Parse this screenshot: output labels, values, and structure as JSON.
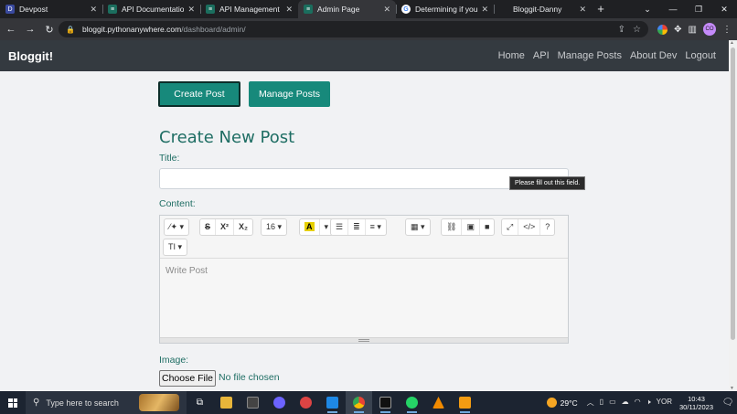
{
  "browser": {
    "tabs": [
      {
        "favicon": "D",
        "favicon_color": "#3a4a9f",
        "title": "Devpost",
        "active": false
      },
      {
        "favicon": "≡",
        "favicon_color": "#1b6e5e",
        "title": "API Documentation",
        "active": false
      },
      {
        "favicon": "≡",
        "favicon_color": "#1b6e5e",
        "title": "API Management",
        "active": false
      },
      {
        "favicon": "≡",
        "favicon_color": "#1b6e5e",
        "title": "Admin Page",
        "active": true
      },
      {
        "favicon": "G",
        "favicon_color": "#ffffff",
        "title": "Determining if your",
        "active": false
      },
      {
        "favicon": "",
        "favicon_color": "transparent",
        "title": "Bloggit-Danny",
        "active": false
      }
    ],
    "url_host": "bloggit.pythonanywhere.com",
    "url_path": "/dashboard/admin/",
    "profile_initials": "CO"
  },
  "site": {
    "brand": "Bloggit!",
    "nav": [
      "Home",
      "API",
      "Manage Posts",
      "About Dev",
      "Logout"
    ]
  },
  "page": {
    "create_post_button": "Create Post",
    "manage_posts_button": "Manage Posts",
    "heading": "Create New Post",
    "title_label": "Title:",
    "content_label": "Content:",
    "tooltip": "Please fill out this field.",
    "editor_placeholder": "Write Post",
    "font_size": "16",
    "image_label": "Image:",
    "choose_file_button": "Choose File",
    "file_status": "No file chosen"
  },
  "taskbar": {
    "search_placeholder": "Type here to search",
    "temperature": "29°C",
    "language": "YOR",
    "time": "10:43",
    "date": "30/11/2023"
  },
  "colors": {
    "accent": "#17897b",
    "heading": "#1f6e64",
    "navbar": "#343a40"
  }
}
